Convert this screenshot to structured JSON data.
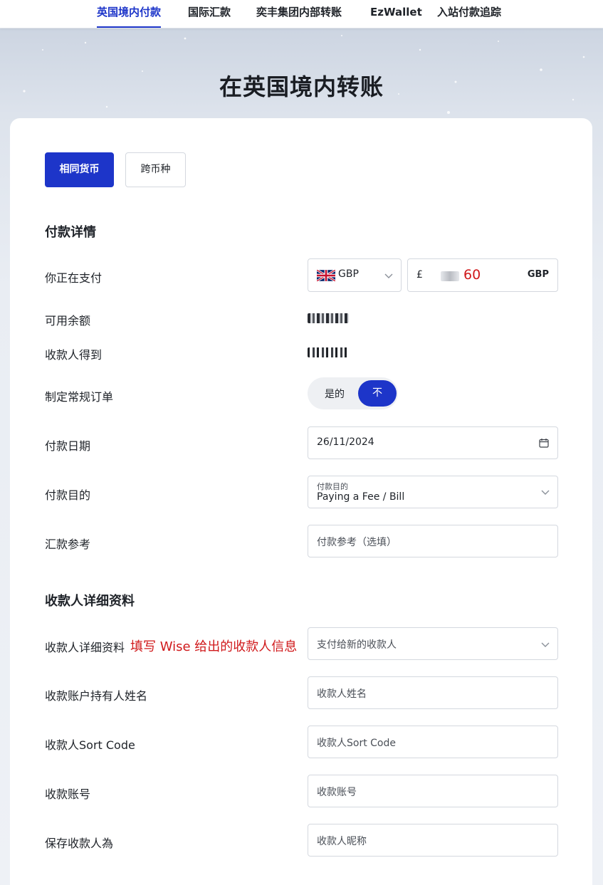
{
  "nav": {
    "tabs": [
      {
        "label": "英国境内付款"
      },
      {
        "label": "国际汇款"
      },
      {
        "label": "奕丰集团内部转账"
      },
      {
        "label": "EzWallet"
      },
      {
        "label": "入站付款追踪"
      }
    ]
  },
  "page": {
    "title": "在英国境内转账"
  },
  "mode": {
    "same_currency": "相同货币",
    "cross_currency": "跨币种"
  },
  "payment": {
    "section_title": "付款详情",
    "paying_label": "你正在支付",
    "currency": "GBP",
    "amount_symbol": "£",
    "amount_value": "60",
    "amount_currency": "GBP",
    "available_label": "可用余额",
    "receive_label": "收款人得到",
    "recurring_label": "制定常规订单",
    "recurring_yes": "是的",
    "recurring_no": "不",
    "date_label": "付款日期",
    "date_value": "26/11/2024",
    "purpose_label": "付款目的",
    "purpose_caption": "付款目的",
    "purpose_value": "Paying a Fee / Bill",
    "reference_label": "汇款参考",
    "reference_placeholder": "付款参考（选填）"
  },
  "beneficiary": {
    "section_title": "收款人详细资料",
    "details_label": "收款人详细资料",
    "annotation": "填写 Wise 给出的收款人信息",
    "details_select": "支付给新的收款人",
    "holder_label": "收款账户持有人姓名",
    "holder_placeholder": "收款人姓名",
    "sortcode_label": "收款人Sort Code",
    "sortcode_placeholder": "收款人Sort Code",
    "account_label": "收款账号",
    "account_placeholder": "收款账号",
    "save_label": "保存收款人為",
    "save_placeholder": "收款人昵称"
  },
  "colors": {
    "accent": "#1d35c9",
    "annotation": "#d0191b"
  }
}
